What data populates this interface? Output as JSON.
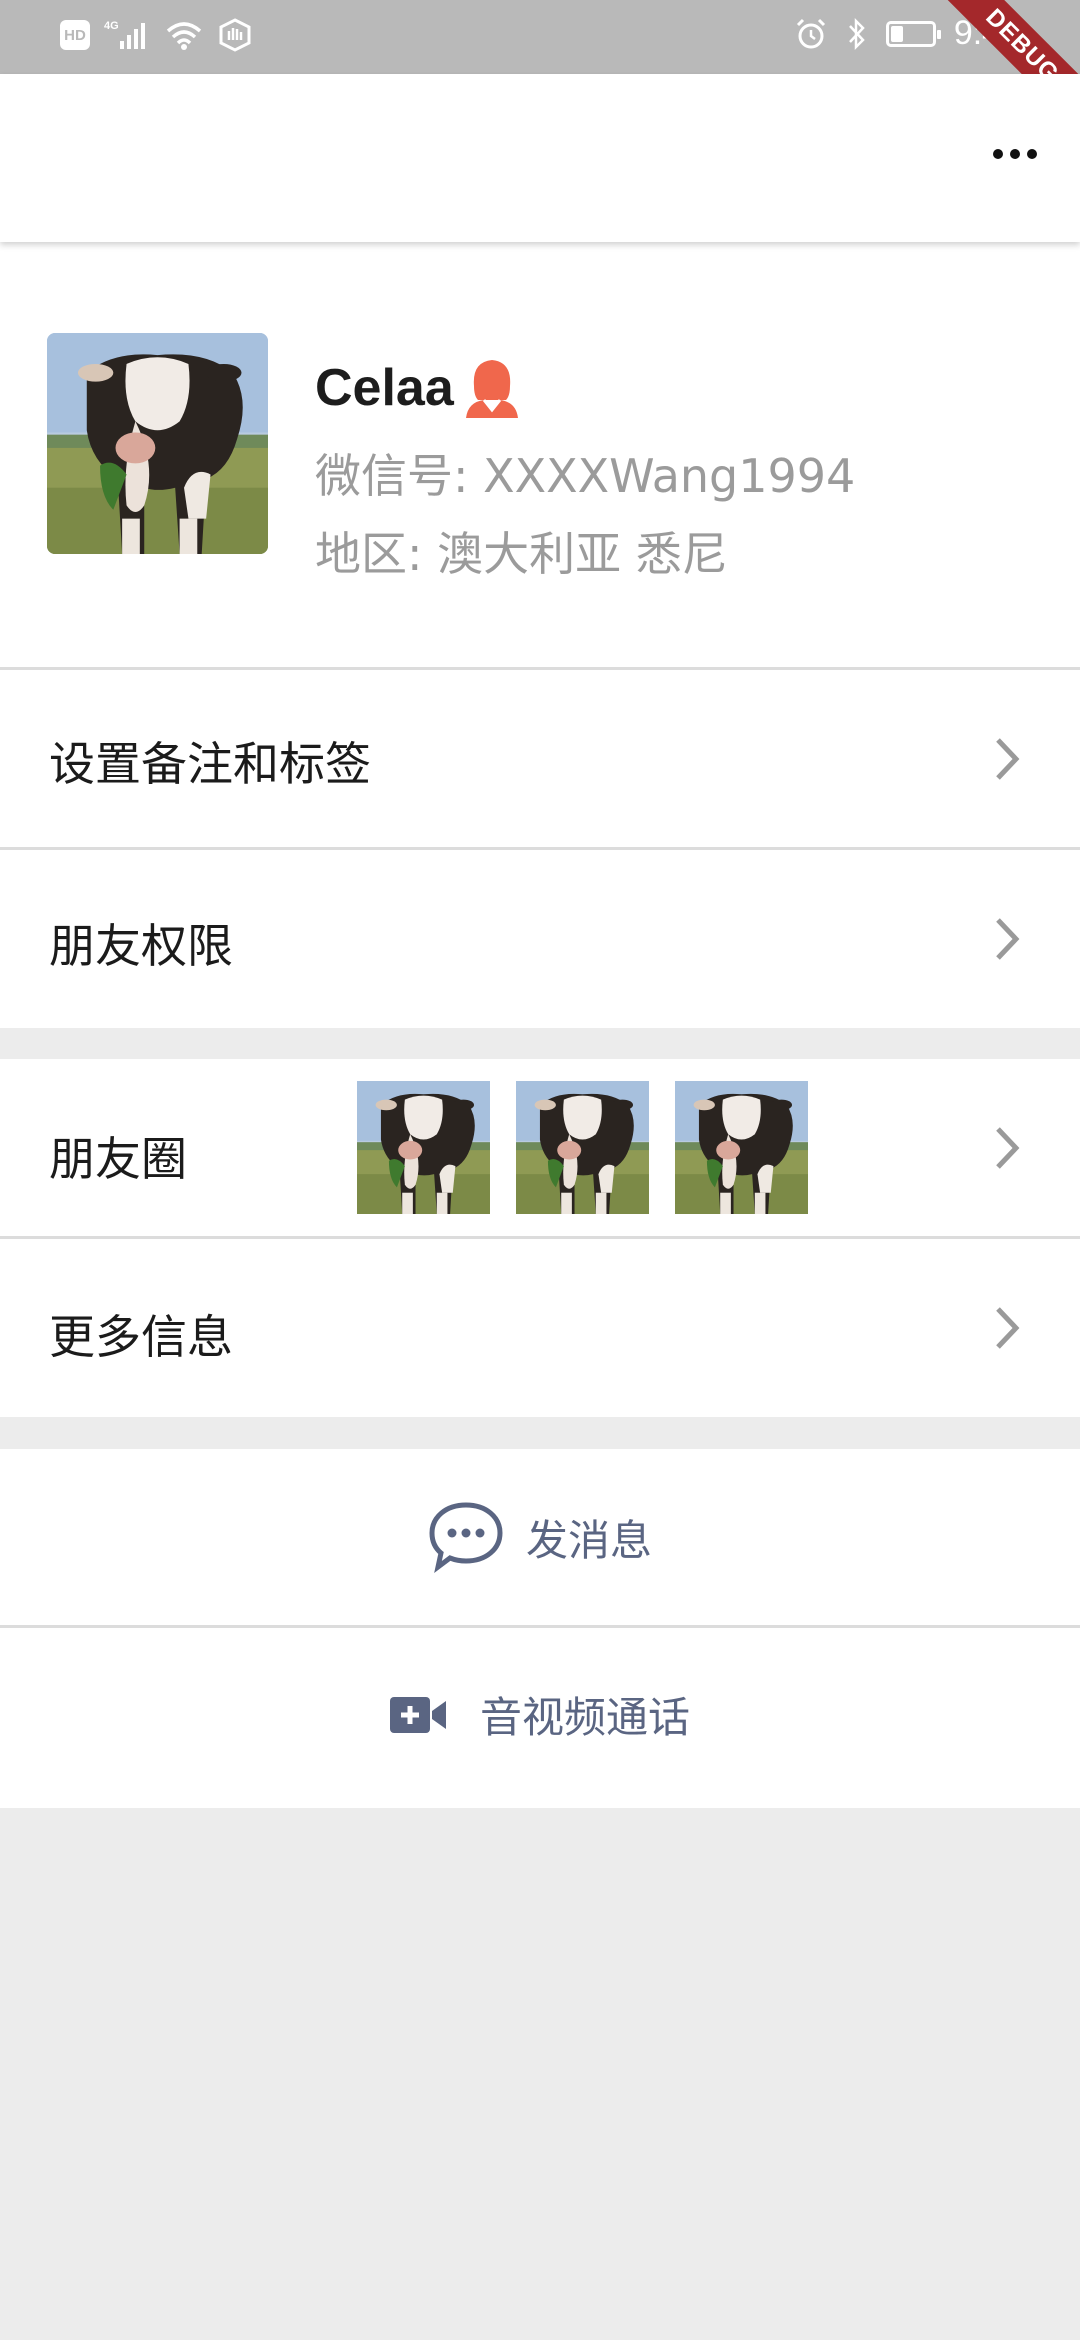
{
  "status_bar": {
    "hd": "HD",
    "network": "4G",
    "time": "9:43",
    "battery_level": 0.3,
    "debug_banner": "DEBUG"
  },
  "app_bar": {
    "more_icon": "more-horizontal-icon"
  },
  "profile": {
    "name": "Celaa",
    "gender_icon": "female-icon",
    "gender_color": "#f0674c",
    "wechat_id": "微信号: XXXXWang1994",
    "region": "地区: 澳大利亚 悉尼"
  },
  "menu": {
    "remark_tags": "设置备注和标签",
    "friend_permissions": "朋友权限",
    "moments": "朋友圈",
    "more_info": "更多信息"
  },
  "actions": {
    "send_message": "发消息",
    "video_call": "音视频通话",
    "accent_color": "#5a6582"
  }
}
